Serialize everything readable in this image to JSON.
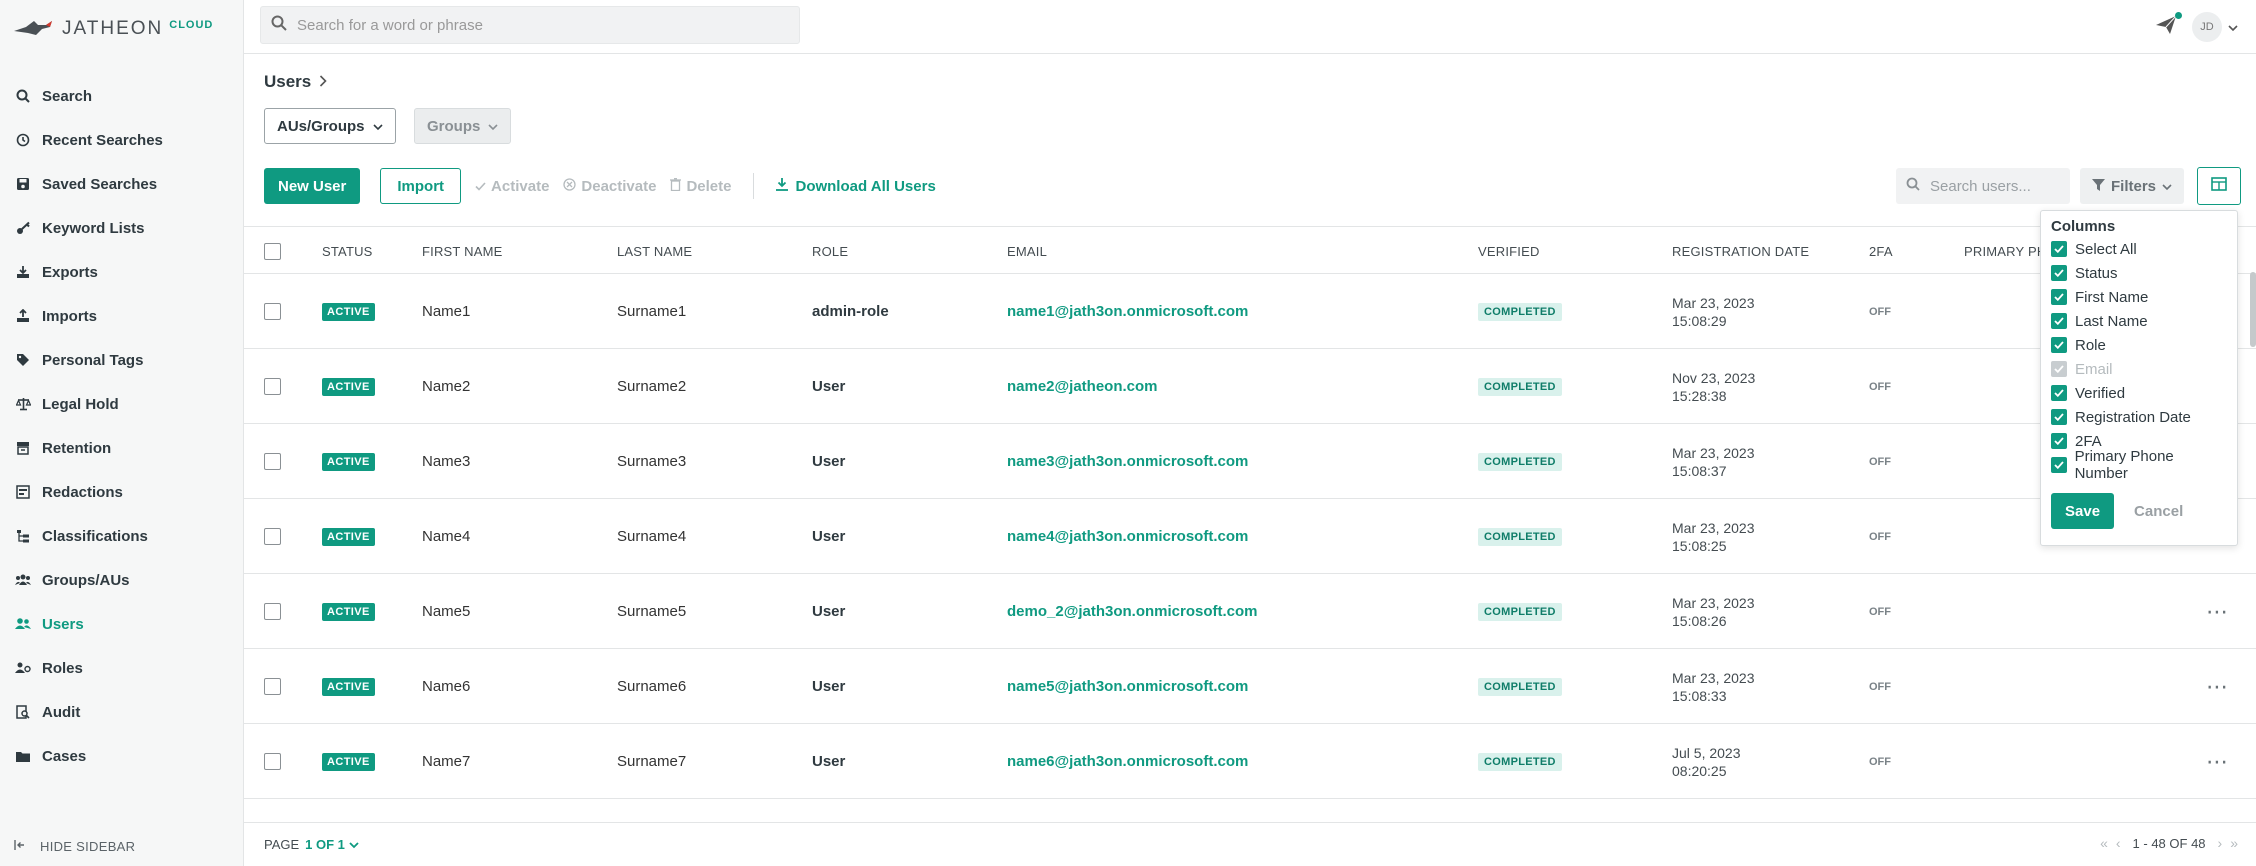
{
  "brand": {
    "name": "JATHEON",
    "suffix": "CLOUD"
  },
  "sidebar": {
    "items": [
      {
        "label": "Search",
        "icon": "search-icon"
      },
      {
        "label": "Recent Searches",
        "icon": "history-icon"
      },
      {
        "label": "Saved Searches",
        "icon": "save-icon"
      },
      {
        "label": "Keyword Lists",
        "icon": "key-icon"
      },
      {
        "label": "Exports",
        "icon": "export-icon"
      },
      {
        "label": "Imports",
        "icon": "import-icon"
      },
      {
        "label": "Personal Tags",
        "icon": "tag-icon"
      },
      {
        "label": "Legal Hold",
        "icon": "scale-icon"
      },
      {
        "label": "Retention",
        "icon": "archive-icon"
      },
      {
        "label": "Redactions",
        "icon": "redaction-icon"
      },
      {
        "label": "Classifications",
        "icon": "tree-icon"
      },
      {
        "label": "Groups/AUs",
        "icon": "group-icon"
      },
      {
        "label": "Users",
        "icon": "users-icon",
        "active": true
      },
      {
        "label": "Roles",
        "icon": "roles-icon"
      },
      {
        "label": "Audit",
        "icon": "audit-icon"
      },
      {
        "label": "Cases",
        "icon": "folder-icon"
      }
    ],
    "hide_label": "HIDE SIDEBAR"
  },
  "topbar": {
    "search_placeholder": "Search for a word or phrase",
    "avatar_initials": "JD"
  },
  "page": {
    "breadcrumb": "Users",
    "aus_groups_label": "AUs/Groups",
    "groups_label": "Groups"
  },
  "toolbar": {
    "new_user": "New User",
    "import": "Import",
    "activate": "Activate",
    "deactivate": "Deactivate",
    "delete": "Delete",
    "download_all": "Download All Users",
    "search_placeholder": "Search users...",
    "filters": "Filters"
  },
  "table": {
    "columns": {
      "status": "STATUS",
      "first_name": "FIRST NAME",
      "last_name": "LAST NAME",
      "role": "ROLE",
      "email": "EMAIL",
      "verified": "VERIFIED",
      "registration_date": "REGISTRATION DATE",
      "twofa": "2FA",
      "primary_phone": "PRIMARY PHO"
    },
    "rows": [
      {
        "status": "ACTIVE",
        "first": "Name1",
        "last": "Surname1",
        "role": "admin-role",
        "email": "name1@jath3on.onmicrosoft.com",
        "verified": "COMPLETED",
        "date": "Mar 23, 2023",
        "time": "15:08:29",
        "twofa": "OFF",
        "more": false
      },
      {
        "status": "ACTIVE",
        "first": "Name2",
        "last": "Surname2",
        "role": "User",
        "email": "name2@jatheon.com",
        "verified": "COMPLETED",
        "date": "Nov 23, 2023",
        "time": "15:28:38",
        "twofa": "OFF",
        "more": false
      },
      {
        "status": "ACTIVE",
        "first": "Name3",
        "last": "Surname3",
        "role": "User",
        "email": "name3@jath3on.onmicrosoft.com",
        "verified": "COMPLETED",
        "date": "Mar 23, 2023",
        "time": "15:08:37",
        "twofa": "OFF",
        "more": false
      },
      {
        "status": "ACTIVE",
        "first": "Name4",
        "last": "Surname4",
        "role": "User",
        "email": "name4@jath3on.onmicrosoft.com",
        "verified": "COMPLETED",
        "date": "Mar 23, 2023",
        "time": "15:08:25",
        "twofa": "OFF",
        "more": false
      },
      {
        "status": "ACTIVE",
        "first": "Name5",
        "last": "Surname5",
        "role": "User",
        "email": "demo_2@jath3on.onmicrosoft.com",
        "verified": "COMPLETED",
        "date": "Mar 23, 2023",
        "time": "15:08:26",
        "twofa": "OFF",
        "more": true
      },
      {
        "status": "ACTIVE",
        "first": "Name6",
        "last": "Surname6",
        "role": "User",
        "email": "name5@jath3on.onmicrosoft.com",
        "verified": "COMPLETED",
        "date": "Mar 23, 2023",
        "time": "15:08:33",
        "twofa": "OFF",
        "more": true
      },
      {
        "status": "ACTIVE",
        "first": "Name7",
        "last": "Surname7",
        "role": "User",
        "email": "name6@jath3on.onmicrosoft.com",
        "verified": "COMPLETED",
        "date": "Jul 5, 2023",
        "time": "08:20:25",
        "twofa": "OFF",
        "more": true
      }
    ],
    "more_glyph": "⋯"
  },
  "columns_popover": {
    "title": "Columns",
    "options": [
      {
        "label": "Select All",
        "checked": true,
        "disabled": false
      },
      {
        "label": "Status",
        "checked": true,
        "disabled": false
      },
      {
        "label": "First Name",
        "checked": true,
        "disabled": false
      },
      {
        "label": "Last Name",
        "checked": true,
        "disabled": false
      },
      {
        "label": "Role",
        "checked": true,
        "disabled": false
      },
      {
        "label": "Email",
        "checked": true,
        "disabled": true
      },
      {
        "label": "Verified",
        "checked": true,
        "disabled": false
      },
      {
        "label": "Registration Date",
        "checked": true,
        "disabled": false
      },
      {
        "label": "2FA",
        "checked": true,
        "disabled": false
      },
      {
        "label": "Primary Phone Number",
        "checked": true,
        "disabled": false
      }
    ],
    "save": "Save",
    "cancel": "Cancel"
  },
  "footer": {
    "page_label": "PAGE",
    "page_value": "1 OF 1",
    "range": "1 - 48 OF 48"
  },
  "colors": {
    "accent": "#0f9a81",
    "sidebar_bg": "#f6f7f7"
  }
}
